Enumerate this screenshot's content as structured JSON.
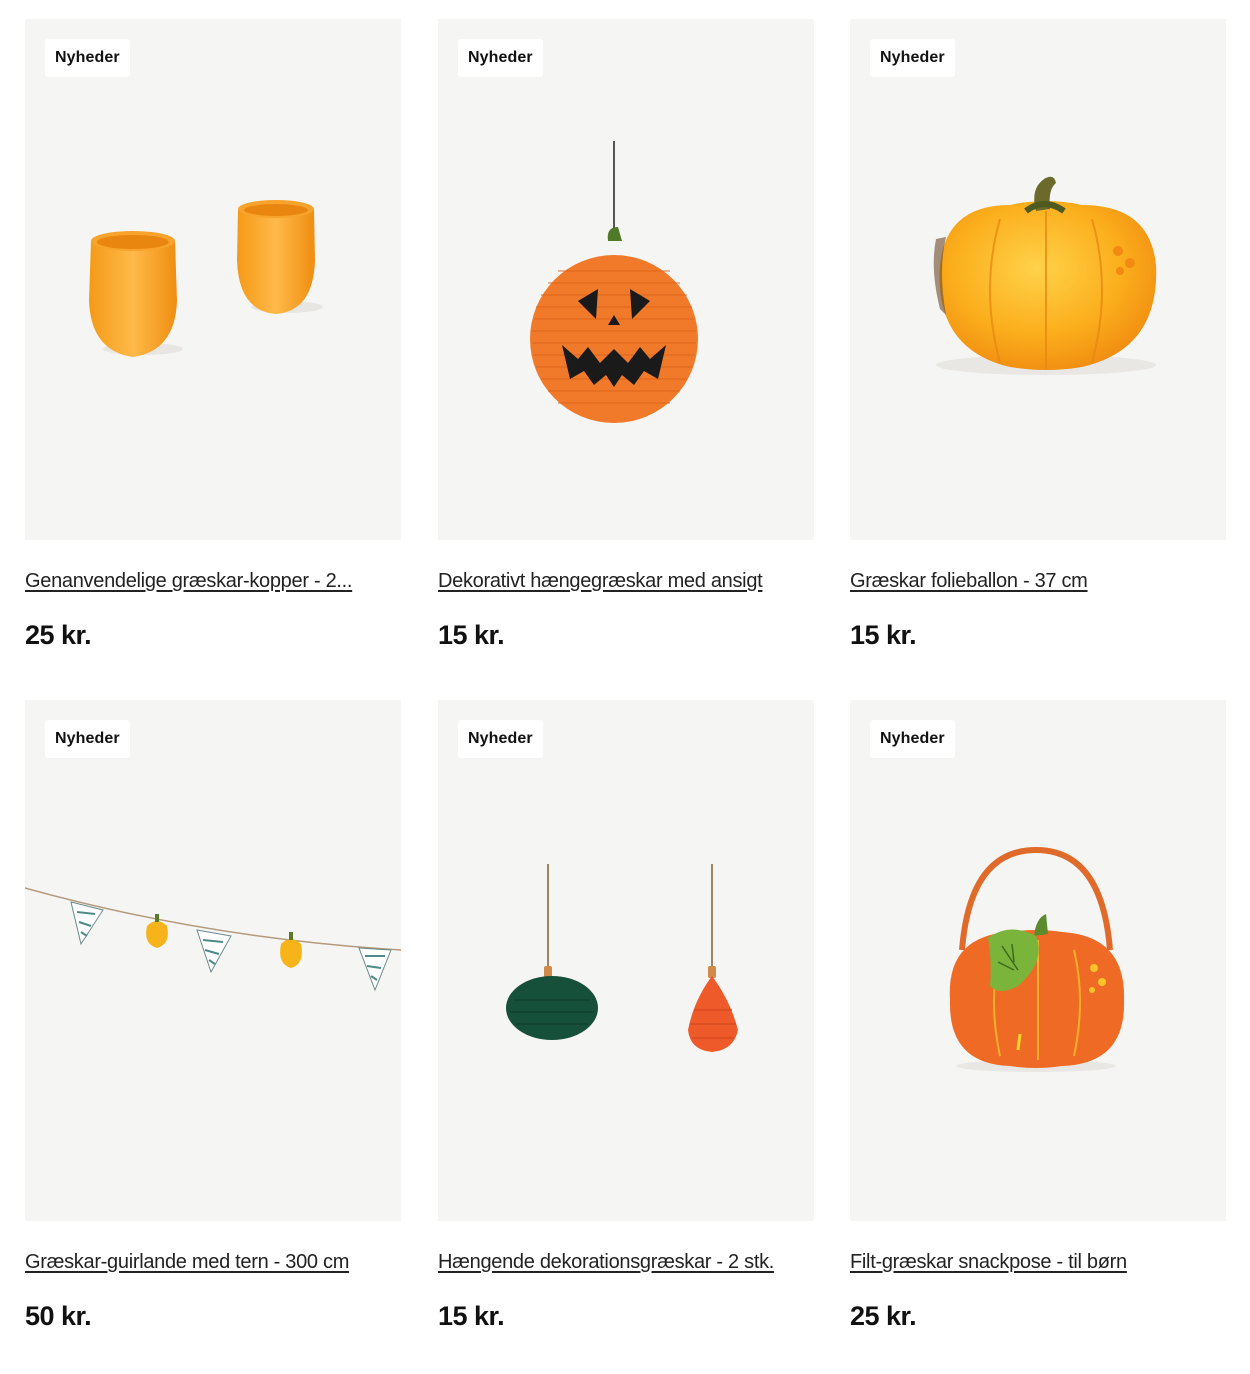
{
  "products": [
    {
      "badge": "Nyheder",
      "title": "Genanvendelige græskar-kopper - 2...",
      "price": "25 kr.",
      "image_icon": "pumpkin-cups-image"
    },
    {
      "badge": "Nyheder",
      "title": "Dekorativt hængegræskar med ansigt",
      "price": "15 kr.",
      "image_icon": "hanging-jack-o-lantern-image"
    },
    {
      "badge": "Nyheder",
      "title": "Græskar folieballon - 37 cm",
      "price": "15 kr.",
      "image_icon": "pumpkin-foil-balloon-image"
    },
    {
      "badge": "Nyheder",
      "title": "Græskar-guirlande med tern - 300 cm",
      "price": "50 kr.",
      "image_icon": "pumpkin-garland-image"
    },
    {
      "badge": "Nyheder",
      "title": "Hængende dekorationsgræskar - 2 stk.",
      "price": "15 kr.",
      "image_icon": "hanging-honeycomb-pumpkins-image"
    },
    {
      "badge": "Nyheder",
      "title": "Filt-græskar snackpose - til børn",
      "price": "25 kr.",
      "image_icon": "felt-pumpkin-bag-image"
    }
  ],
  "colors": {
    "card_background": "#f5f5f4",
    "badge_background": "#ffffff",
    "pumpkin_orange": "#f08a1c",
    "text": "#111111"
  }
}
